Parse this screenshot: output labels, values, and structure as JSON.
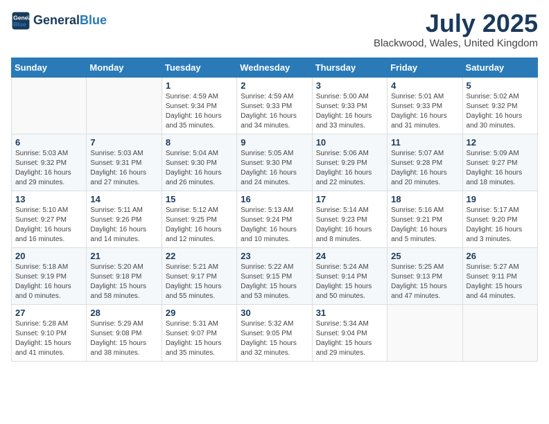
{
  "header": {
    "logo_line1": "General",
    "logo_line2": "Blue",
    "month_year": "July 2025",
    "location": "Blackwood, Wales, United Kingdom"
  },
  "weekdays": [
    "Sunday",
    "Monday",
    "Tuesday",
    "Wednesday",
    "Thursday",
    "Friday",
    "Saturday"
  ],
  "weeks": [
    [
      {
        "day": "",
        "info": ""
      },
      {
        "day": "",
        "info": ""
      },
      {
        "day": "1",
        "info": "Sunrise: 4:59 AM\nSunset: 9:34 PM\nDaylight: 16 hours and 35 minutes."
      },
      {
        "day": "2",
        "info": "Sunrise: 4:59 AM\nSunset: 9:33 PM\nDaylight: 16 hours and 34 minutes."
      },
      {
        "day": "3",
        "info": "Sunrise: 5:00 AM\nSunset: 9:33 PM\nDaylight: 16 hours and 33 minutes."
      },
      {
        "day": "4",
        "info": "Sunrise: 5:01 AM\nSunset: 9:33 PM\nDaylight: 16 hours and 31 minutes."
      },
      {
        "day": "5",
        "info": "Sunrise: 5:02 AM\nSunset: 9:32 PM\nDaylight: 16 hours and 30 minutes."
      }
    ],
    [
      {
        "day": "6",
        "info": "Sunrise: 5:03 AM\nSunset: 9:32 PM\nDaylight: 16 hours and 29 minutes."
      },
      {
        "day": "7",
        "info": "Sunrise: 5:03 AM\nSunset: 9:31 PM\nDaylight: 16 hours and 27 minutes."
      },
      {
        "day": "8",
        "info": "Sunrise: 5:04 AM\nSunset: 9:30 PM\nDaylight: 16 hours and 26 minutes."
      },
      {
        "day": "9",
        "info": "Sunrise: 5:05 AM\nSunset: 9:30 PM\nDaylight: 16 hours and 24 minutes."
      },
      {
        "day": "10",
        "info": "Sunrise: 5:06 AM\nSunset: 9:29 PM\nDaylight: 16 hours and 22 minutes."
      },
      {
        "day": "11",
        "info": "Sunrise: 5:07 AM\nSunset: 9:28 PM\nDaylight: 16 hours and 20 minutes."
      },
      {
        "day": "12",
        "info": "Sunrise: 5:09 AM\nSunset: 9:27 PM\nDaylight: 16 hours and 18 minutes."
      }
    ],
    [
      {
        "day": "13",
        "info": "Sunrise: 5:10 AM\nSunset: 9:27 PM\nDaylight: 16 hours and 16 minutes."
      },
      {
        "day": "14",
        "info": "Sunrise: 5:11 AM\nSunset: 9:26 PM\nDaylight: 16 hours and 14 minutes."
      },
      {
        "day": "15",
        "info": "Sunrise: 5:12 AM\nSunset: 9:25 PM\nDaylight: 16 hours and 12 minutes."
      },
      {
        "day": "16",
        "info": "Sunrise: 5:13 AM\nSunset: 9:24 PM\nDaylight: 16 hours and 10 minutes."
      },
      {
        "day": "17",
        "info": "Sunrise: 5:14 AM\nSunset: 9:23 PM\nDaylight: 16 hours and 8 minutes."
      },
      {
        "day": "18",
        "info": "Sunrise: 5:16 AM\nSunset: 9:21 PM\nDaylight: 16 hours and 5 minutes."
      },
      {
        "day": "19",
        "info": "Sunrise: 5:17 AM\nSunset: 9:20 PM\nDaylight: 16 hours and 3 minutes."
      }
    ],
    [
      {
        "day": "20",
        "info": "Sunrise: 5:18 AM\nSunset: 9:19 PM\nDaylight: 16 hours and 0 minutes."
      },
      {
        "day": "21",
        "info": "Sunrise: 5:20 AM\nSunset: 9:18 PM\nDaylight: 15 hours and 58 minutes."
      },
      {
        "day": "22",
        "info": "Sunrise: 5:21 AM\nSunset: 9:17 PM\nDaylight: 15 hours and 55 minutes."
      },
      {
        "day": "23",
        "info": "Sunrise: 5:22 AM\nSunset: 9:15 PM\nDaylight: 15 hours and 53 minutes."
      },
      {
        "day": "24",
        "info": "Sunrise: 5:24 AM\nSunset: 9:14 PM\nDaylight: 15 hours and 50 minutes."
      },
      {
        "day": "25",
        "info": "Sunrise: 5:25 AM\nSunset: 9:13 PM\nDaylight: 15 hours and 47 minutes."
      },
      {
        "day": "26",
        "info": "Sunrise: 5:27 AM\nSunset: 9:11 PM\nDaylight: 15 hours and 44 minutes."
      }
    ],
    [
      {
        "day": "27",
        "info": "Sunrise: 5:28 AM\nSunset: 9:10 PM\nDaylight: 15 hours and 41 minutes."
      },
      {
        "day": "28",
        "info": "Sunrise: 5:29 AM\nSunset: 9:08 PM\nDaylight: 15 hours and 38 minutes."
      },
      {
        "day": "29",
        "info": "Sunrise: 5:31 AM\nSunset: 9:07 PM\nDaylight: 15 hours and 35 minutes."
      },
      {
        "day": "30",
        "info": "Sunrise: 5:32 AM\nSunset: 9:05 PM\nDaylight: 15 hours and 32 minutes."
      },
      {
        "day": "31",
        "info": "Sunrise: 5:34 AM\nSunset: 9:04 PM\nDaylight: 15 hours and 29 minutes."
      },
      {
        "day": "",
        "info": ""
      },
      {
        "day": "",
        "info": ""
      }
    ]
  ]
}
